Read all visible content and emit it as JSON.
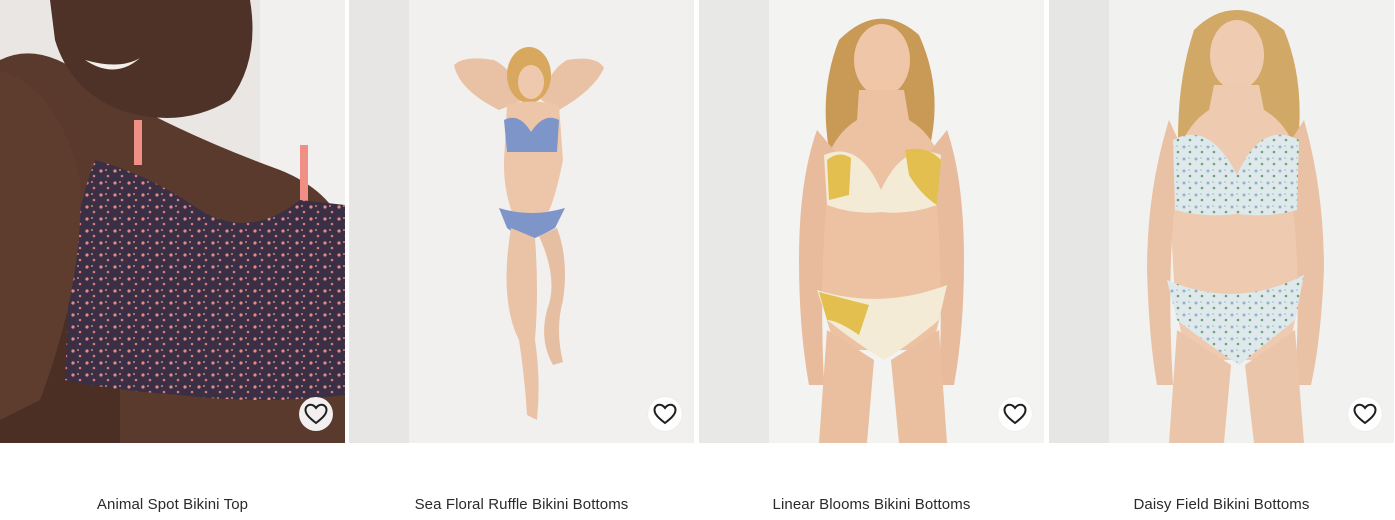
{
  "products": [
    {
      "name": "Animal Spot Bikini Top",
      "wishlist_icon": "heart-outline-icon"
    },
    {
      "name": "Sea Floral Ruffle Bikini Bottoms",
      "wishlist_icon": "heart-outline-icon"
    },
    {
      "name": "Linear Blooms Bikini Bottoms",
      "wishlist_icon": "heart-outline-icon"
    },
    {
      "name": "Daisy Field Bikini Bottoms",
      "wishlist_icon": "heart-outline-icon"
    }
  ],
  "colors": {
    "background": "#ffffff",
    "text": "#2a2a2a",
    "print_dark": "#3a2f44",
    "print_pink": "#e58a84",
    "print_blue": "#7d95c9",
    "print_yellow": "#e3bf4f",
    "print_floral": "#c9dbe3"
  }
}
